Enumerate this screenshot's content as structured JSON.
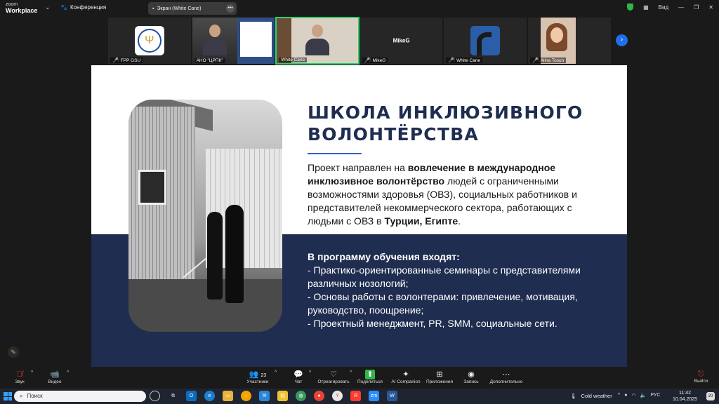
{
  "app": {
    "brand_top": "zoom",
    "brand_bottom": "Workplace",
    "meeting_label": "Конференция",
    "share_pill": "Экран (White Cane)",
    "view_label": "Вид"
  },
  "participants": [
    {
      "name": "FPP GSU",
      "muted": true
    },
    {
      "name": "АНО \"ЦРПК\"",
      "muted": false
    },
    {
      "name": "White Cane",
      "muted": false
    },
    {
      "name": "MikeG",
      "display": "MikeG",
      "muted": true
    },
    {
      "name": "White Cane",
      "muted": true
    },
    {
      "name": "Alina Tosun",
      "muted": true
    }
  ],
  "slide": {
    "title_line1": "ШКОЛА ИНКЛЮЗИВНОГО",
    "title_line2": "ВОЛОНТЁРСТВА",
    "para_prefix": " Проект направлен на ",
    "para_bold1": "вовлечение в международное инклюзивное волонтёрство",
    "para_mid": " людей с ограниченными возможностями здоровья (ОВЗ), социальных работников и представителей некоммерческого сектора, работающих с людьми с ОВЗ в ",
    "para_bold2": "Турции, Египте",
    "para_end": ".",
    "program_heading": "В программу обучения входят:",
    "program_items": [
      "- Практико-ориентированные семинары с представителями различных нозологий;",
      "- Основы работы с волонтерами: привлечение, мотивация, руководство, поощрение;",
      "- Проектный менеджмент, PR, SMM, социальные сети."
    ]
  },
  "toolbar": {
    "audio": "Звук",
    "video": "Видео",
    "participants_count": "23",
    "participants": "Участники",
    "chat": "Чат",
    "react": "Отреагировать",
    "share": "Поделиться",
    "ai": "AI Companion",
    "apps": "Приложения",
    "record": "Запись",
    "more": "Дополнительно",
    "leave": "Выйти"
  },
  "taskbar": {
    "search_placeholder": "Поиск",
    "weather": "Cold weather",
    "lang": "РУС",
    "time": "11:42",
    "date": "10.04.2025",
    "notif_count": "20"
  }
}
